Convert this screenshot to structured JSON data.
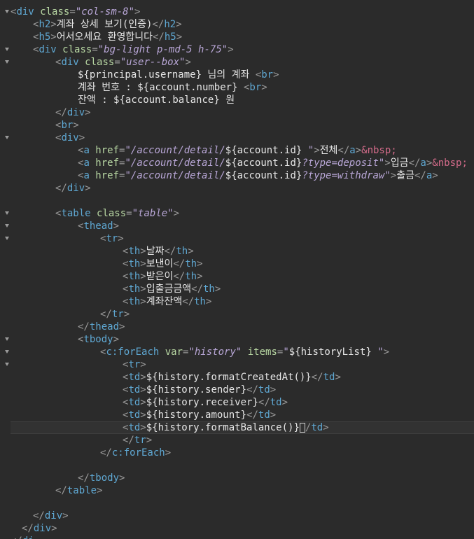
{
  "colors": {
    "background": "#2b2b2b",
    "tag": "#5fa8d3",
    "attribute": "#b8d7a3",
    "value": "#b8a6d6",
    "entity": "#d36b8a",
    "text": "#e6e6e6"
  },
  "gutter": {
    "marks": [
      "",
      "",
      "",
      "5",
      "",
      "",
      "",
      "",
      "2",
      "",
      "",
      "",
      "",
      "5",
      "",
      "",
      "",
      "",
      "",
      "",
      "",
      "",
      "",
      "",
      "2",
      "",
      "",
      "",
      "",
      "",
      "",
      "",
      "",
      "",
      "",
      "",
      "",
      "",
      "",
      "",
      "",
      "",
      ""
    ]
  },
  "lines": [
    {
      "i": 0,
      "tok": [
        [
          "p",
          "<"
        ],
        [
          "t",
          "div"
        ],
        [
          "a",
          " class"
        ],
        [
          "p",
          "="
        ],
        [
          "v",
          "\"col-sm-8\""
        ],
        [
          "p",
          ">"
        ]
      ]
    },
    {
      "i": 2,
      "tok": [
        [
          "p",
          "<"
        ],
        [
          "t",
          "h2"
        ],
        [
          "p",
          ">"
        ],
        [
          "x",
          "계좌 상세 보기(인증)"
        ],
        [
          "p",
          "</"
        ],
        [
          "t",
          "h2"
        ],
        [
          "p",
          ">"
        ]
      ]
    },
    {
      "i": 2,
      "tok": [
        [
          "p",
          "<"
        ],
        [
          "t",
          "h5"
        ],
        [
          "p",
          ">"
        ],
        [
          "x",
          "어서오세요 환영합니다"
        ],
        [
          "p",
          "</"
        ],
        [
          "t",
          "h5"
        ],
        [
          "p",
          ">"
        ]
      ]
    },
    {
      "i": 2,
      "tok": [
        [
          "p",
          "<"
        ],
        [
          "t",
          "div"
        ],
        [
          "a",
          " class"
        ],
        [
          "p",
          "="
        ],
        [
          "v",
          "\"bg-light p-md-5 h-75\""
        ],
        [
          "p",
          ">"
        ]
      ]
    },
    {
      "i": 4,
      "tok": [
        [
          "p",
          "<"
        ],
        [
          "t",
          "div"
        ],
        [
          "a",
          " class"
        ],
        [
          "p",
          "="
        ],
        [
          "v",
          "\"user--box\""
        ],
        [
          "p",
          ">"
        ]
      ]
    },
    {
      "i": 6,
      "tok": [
        [
          "x",
          "${principal.username} 님의 계좌 "
        ],
        [
          "p",
          "<"
        ],
        [
          "t",
          "br"
        ],
        [
          "p",
          ">"
        ]
      ]
    },
    {
      "i": 6,
      "tok": [
        [
          "x",
          "계좌 번호 : ${account.number} "
        ],
        [
          "p",
          "<"
        ],
        [
          "t",
          "br"
        ],
        [
          "p",
          ">"
        ]
      ]
    },
    {
      "i": 6,
      "tok": [
        [
          "x",
          "잔액 : ${account.balance} 원"
        ]
      ]
    },
    {
      "i": 4,
      "tok": [
        [
          "p",
          "</"
        ],
        [
          "t",
          "div"
        ],
        [
          "p",
          ">"
        ]
      ]
    },
    {
      "i": 4,
      "tok": [
        [
          "p",
          "<"
        ],
        [
          "t",
          "br"
        ],
        [
          "p",
          ">"
        ]
      ]
    },
    {
      "i": 4,
      "tok": [
        [
          "p",
          "<"
        ],
        [
          "t",
          "div"
        ],
        [
          "p",
          ">"
        ]
      ]
    },
    {
      "i": 6,
      "tok": [
        [
          "p",
          "<"
        ],
        [
          "t",
          "a"
        ],
        [
          "a",
          " href"
        ],
        [
          "p",
          "="
        ],
        [
          "v",
          "\"/account/detail/"
        ],
        [
          "x",
          "${account.id}"
        ],
        [
          "v",
          " \""
        ],
        [
          "p",
          ">"
        ],
        [
          "x",
          "전체"
        ],
        [
          "p",
          "</"
        ],
        [
          "t",
          "a"
        ],
        [
          "p",
          ">"
        ],
        [
          "ent",
          "&nbsp;"
        ]
      ]
    },
    {
      "i": 6,
      "tok": [
        [
          "p",
          "<"
        ],
        [
          "t",
          "a"
        ],
        [
          "a",
          " href"
        ],
        [
          "p",
          "="
        ],
        [
          "v",
          "\"/account/detail/"
        ],
        [
          "x",
          "${account.id}"
        ],
        [
          "v",
          "?type=deposit\""
        ],
        [
          "p",
          ">"
        ],
        [
          "x",
          "입금"
        ],
        [
          "p",
          "</"
        ],
        [
          "t",
          "a"
        ],
        [
          "p",
          ">"
        ],
        [
          "ent",
          "&nbsp;"
        ]
      ]
    },
    {
      "i": 6,
      "tok": [
        [
          "p",
          "<"
        ],
        [
          "t",
          "a"
        ],
        [
          "a",
          " href"
        ],
        [
          "p",
          "="
        ],
        [
          "v",
          "\"/account/detail/"
        ],
        [
          "x",
          "${account.id}"
        ],
        [
          "v",
          "?type=withdraw\""
        ],
        [
          "p",
          ">"
        ],
        [
          "x",
          "출금"
        ],
        [
          "p",
          "</"
        ],
        [
          "t",
          "a"
        ],
        [
          "p",
          ">"
        ]
      ]
    },
    {
      "i": 4,
      "tok": [
        [
          "p",
          "</"
        ],
        [
          "t",
          "div"
        ],
        [
          "p",
          ">"
        ]
      ]
    },
    {
      "i": 0,
      "tok": []
    },
    {
      "i": 4,
      "tok": [
        [
          "p",
          "<"
        ],
        [
          "t",
          "table"
        ],
        [
          "a",
          " class"
        ],
        [
          "p",
          "="
        ],
        [
          "v",
          "\"table\""
        ],
        [
          "p",
          ">"
        ]
      ]
    },
    {
      "i": 6,
      "tok": [
        [
          "p",
          "<"
        ],
        [
          "t",
          "thead"
        ],
        [
          "p",
          ">"
        ]
      ]
    },
    {
      "i": 8,
      "tok": [
        [
          "p",
          "<"
        ],
        [
          "t",
          "tr"
        ],
        [
          "p",
          ">"
        ]
      ]
    },
    {
      "i": 10,
      "tok": [
        [
          "p",
          "<"
        ],
        [
          "t",
          "th"
        ],
        [
          "p",
          ">"
        ],
        [
          "x",
          "날짜"
        ],
        [
          "p",
          "</"
        ],
        [
          "t",
          "th"
        ],
        [
          "p",
          ">"
        ]
      ]
    },
    {
      "i": 10,
      "tok": [
        [
          "p",
          "<"
        ],
        [
          "t",
          "th"
        ],
        [
          "p",
          ">"
        ],
        [
          "x",
          "보낸이"
        ],
        [
          "p",
          "</"
        ],
        [
          "t",
          "th"
        ],
        [
          "p",
          ">"
        ]
      ]
    },
    {
      "i": 10,
      "tok": [
        [
          "p",
          "<"
        ],
        [
          "t",
          "th"
        ],
        [
          "p",
          ">"
        ],
        [
          "x",
          "받은이"
        ],
        [
          "p",
          "</"
        ],
        [
          "t",
          "th"
        ],
        [
          "p",
          ">"
        ]
      ]
    },
    {
      "i": 10,
      "tok": [
        [
          "p",
          "<"
        ],
        [
          "t",
          "th"
        ],
        [
          "p",
          ">"
        ],
        [
          "x",
          "입출금금액"
        ],
        [
          "p",
          "</"
        ],
        [
          "t",
          "th"
        ],
        [
          "p",
          ">"
        ]
      ]
    },
    {
      "i": 10,
      "tok": [
        [
          "p",
          "<"
        ],
        [
          "t",
          "th"
        ],
        [
          "p",
          ">"
        ],
        [
          "x",
          "계좌잔액"
        ],
        [
          "p",
          "</"
        ],
        [
          "t",
          "th"
        ],
        [
          "p",
          ">"
        ]
      ]
    },
    {
      "i": 8,
      "tok": [
        [
          "p",
          "</"
        ],
        [
          "t",
          "tr"
        ],
        [
          "p",
          ">"
        ]
      ]
    },
    {
      "i": 6,
      "tok": [
        [
          "p",
          "</"
        ],
        [
          "t",
          "thead"
        ],
        [
          "p",
          ">"
        ]
      ]
    },
    {
      "i": 6,
      "tok": [
        [
          "p",
          "<"
        ],
        [
          "t",
          "tbody"
        ],
        [
          "p",
          ">"
        ]
      ]
    },
    {
      "i": 8,
      "tok": [
        [
          "p",
          "<"
        ],
        [
          "t",
          "c:forEach"
        ],
        [
          "a",
          " var"
        ],
        [
          "p",
          "="
        ],
        [
          "v",
          "\"history\""
        ],
        [
          "a",
          " items"
        ],
        [
          "p",
          "="
        ],
        [
          "v",
          "\""
        ],
        [
          "x",
          "${historyList}"
        ],
        [
          "v",
          " \""
        ],
        [
          "p",
          ">"
        ]
      ]
    },
    {
      "i": 10,
      "tok": [
        [
          "p",
          "<"
        ],
        [
          "t",
          "tr"
        ],
        [
          "p",
          ">"
        ]
      ]
    },
    {
      "i": 10,
      "tok": [
        [
          "p",
          "<"
        ],
        [
          "t",
          "td"
        ],
        [
          "p",
          ">"
        ],
        [
          "x",
          "${history.formatCreatedAt()}"
        ],
        [
          "p",
          "</"
        ],
        [
          "t",
          "td"
        ],
        [
          "p",
          ">"
        ]
      ]
    },
    {
      "i": 10,
      "tok": [
        [
          "p",
          "<"
        ],
        [
          "t",
          "td"
        ],
        [
          "p",
          ">"
        ],
        [
          "x",
          "${history.sender}"
        ],
        [
          "p",
          "</"
        ],
        [
          "t",
          "td"
        ],
        [
          "p",
          ">"
        ]
      ]
    },
    {
      "i": 10,
      "tok": [
        [
          "p",
          "<"
        ],
        [
          "t",
          "td"
        ],
        [
          "p",
          ">"
        ],
        [
          "x",
          "${history.receiver}"
        ],
        [
          "p",
          "</"
        ],
        [
          "t",
          "td"
        ],
        [
          "p",
          ">"
        ]
      ]
    },
    {
      "i": 10,
      "tok": [
        [
          "p",
          "<"
        ],
        [
          "t",
          "td"
        ],
        [
          "p",
          ">"
        ],
        [
          "x",
          "${history.amount}"
        ],
        [
          "p",
          "</"
        ],
        [
          "t",
          "td"
        ],
        [
          "p",
          ">"
        ]
      ]
    },
    {
      "i": 10,
      "tok": [
        [
          "p",
          "<"
        ],
        [
          "t",
          "td"
        ],
        [
          "p",
          ">"
        ],
        [
          "x",
          "${history.formatBalance()}"
        ],
        [
          "cur",
          ""
        ],
        [
          "p",
          "/"
        ],
        [
          "t",
          "td"
        ],
        [
          "p",
          ">"
        ]
      ],
      "current": true
    },
    {
      "i": 10,
      "tok": [
        [
          "p",
          "</"
        ],
        [
          "t",
          "tr"
        ],
        [
          "p",
          ">"
        ]
      ]
    },
    {
      "i": 8,
      "tok": [
        [
          "p",
          "</"
        ],
        [
          "t",
          "c:forEach"
        ],
        [
          "p",
          ">"
        ]
      ]
    },
    {
      "i": 0,
      "tok": []
    },
    {
      "i": 6,
      "tok": [
        [
          "p",
          "</"
        ],
        [
          "t",
          "tbody"
        ],
        [
          "p",
          ">"
        ]
      ]
    },
    {
      "i": 4,
      "tok": [
        [
          "p",
          "</"
        ],
        [
          "t",
          "table"
        ],
        [
          "p",
          ">"
        ]
      ]
    },
    {
      "i": 0,
      "tok": []
    },
    {
      "i": 2,
      "tok": [
        [
          "p",
          "</"
        ],
        [
          "t",
          "div"
        ],
        [
          "p",
          ">"
        ]
      ]
    },
    {
      "i": 1,
      "tok": [
        [
          "p",
          "</"
        ],
        [
          "t",
          "div"
        ],
        [
          "p",
          ">"
        ]
      ]
    },
    {
      "i": 0,
      "tok": [
        [
          "p",
          "</"
        ],
        [
          "t",
          "di"
        ]
      ]
    }
  ]
}
